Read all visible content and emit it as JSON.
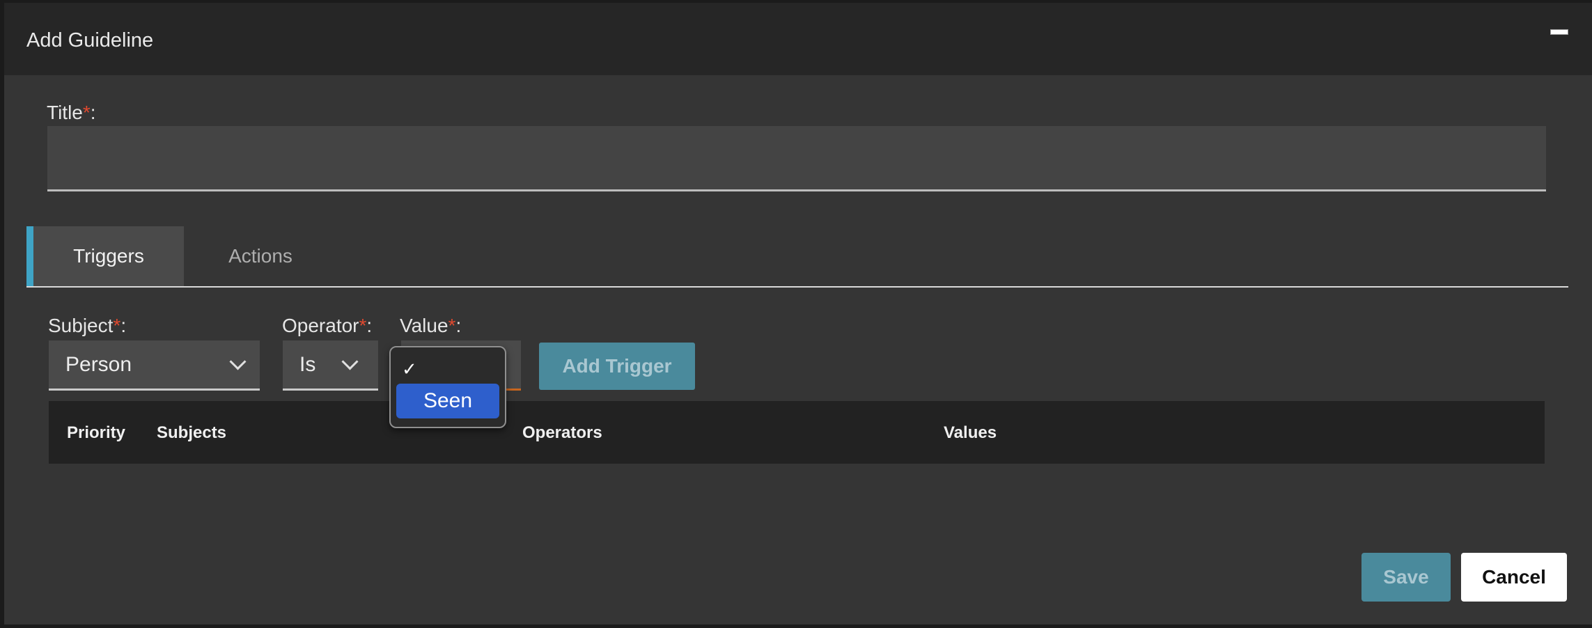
{
  "dialog": {
    "title": "Add Guideline",
    "minimize_icon": "minimize-icon"
  },
  "title_field": {
    "label": "Title",
    "required_mark": "*",
    "suffix": ":",
    "value": ""
  },
  "tabs": [
    {
      "label": "Triggers",
      "active": true
    },
    {
      "label": "Actions",
      "active": false
    }
  ],
  "colors": {
    "accent": "#3fa4c6",
    "required": "#e0492f",
    "primary_button": "#4a8a9c",
    "selected_option": "#2e5fcc"
  },
  "trigger_form": {
    "subject": {
      "label": "Subject",
      "required_mark": "*",
      "suffix": ":",
      "value": "Person"
    },
    "operator": {
      "label": "Operator",
      "required_mark": "*",
      "suffix": ":",
      "value": "Is"
    },
    "value": {
      "label": "Value",
      "required_mark": "*",
      "suffix": ":"
    },
    "add_button": "Add Trigger"
  },
  "value_dropdown": {
    "check": "✓",
    "options": [
      "Seen"
    ],
    "highlighted": "Seen"
  },
  "table": {
    "headers": [
      "Priority",
      "Subjects",
      "Operators",
      "Values"
    ]
  },
  "footer": {
    "save_label": "Save",
    "cancel_label": "Cancel"
  }
}
